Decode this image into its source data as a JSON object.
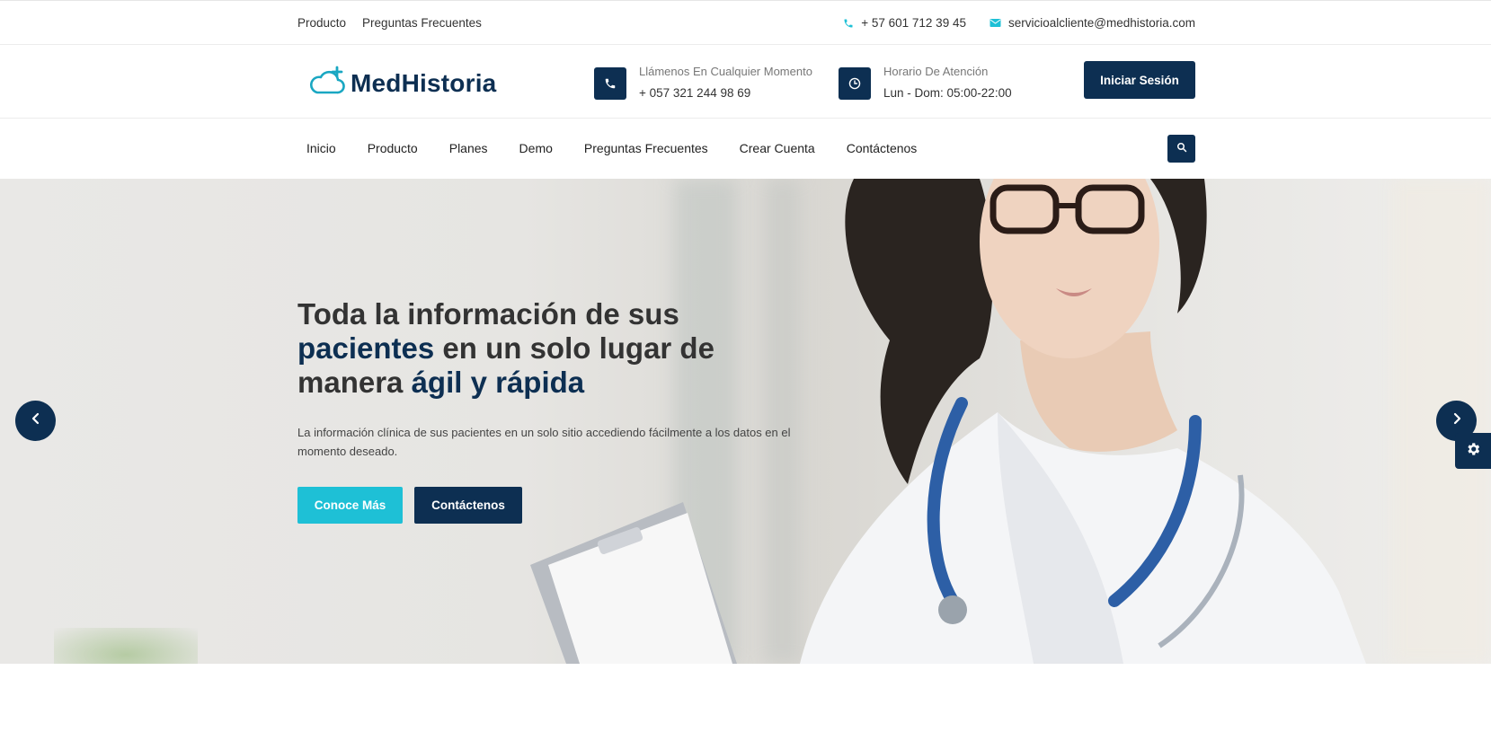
{
  "topbar": {
    "links": [
      "Producto",
      "Preguntas Frecuentes"
    ],
    "phone": "+ 57 601 712 39 45",
    "email": "servicioalcliente@medhistoria.com"
  },
  "header": {
    "logo_text": "MedHistoria",
    "call": {
      "label": "Llámenos En Cualquier Momento",
      "value": "+ 057 321 244 98 69"
    },
    "hours": {
      "label": "Horario De Atención",
      "value": "Lun - Dom: 05:00-22:00"
    },
    "login_label": "Iniciar Sesión"
  },
  "nav": {
    "items": [
      "Inicio",
      "Producto",
      "Planes",
      "Demo",
      "Preguntas Frecuentes",
      "Crear Cuenta",
      "Contáctenos"
    ]
  },
  "hero": {
    "title_p1": "Toda la información de sus ",
    "title_hl1": "pacientes",
    "title_p2": " en un solo lugar de manera ",
    "title_hl2": "ágil y rápida",
    "subtitle": "La información clínica de sus pacientes en un solo sitio accediendo fácilmente a los datos en el momento deseado.",
    "btn_primary": "Conoce Más",
    "btn_secondary": "Contáctenos"
  },
  "colors": {
    "brand": "#0d2f52",
    "accent": "#1ec0d6"
  },
  "icons": [
    "phone-icon",
    "envelope-icon",
    "clock-icon",
    "search-icon",
    "chevron-left-icon",
    "chevron-right-icon",
    "gear-icon",
    "cloud-plus-icon"
  ]
}
